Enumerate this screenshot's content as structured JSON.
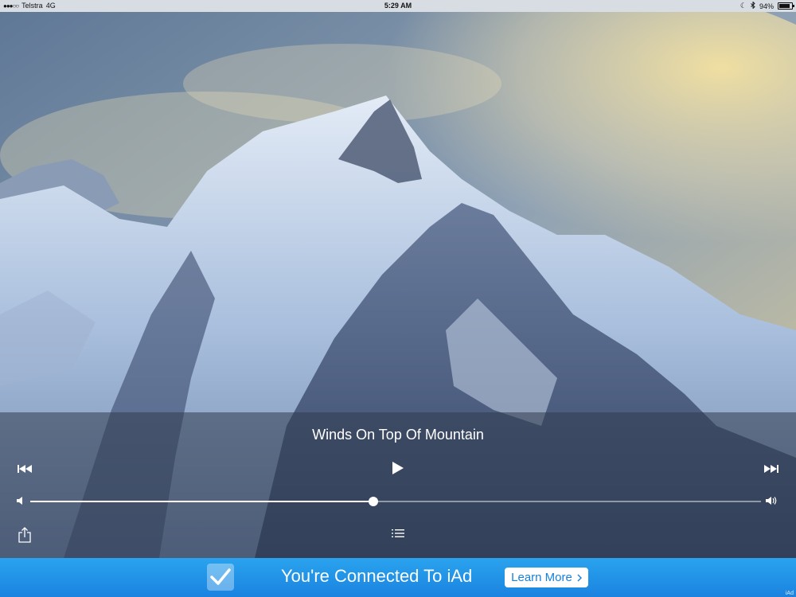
{
  "status_bar": {
    "carrier": "Telstra",
    "network": "4G",
    "time": "5:29 AM",
    "battery": "94%"
  },
  "player": {
    "track_title": "Winds On Top Of Mountain",
    "volume_level": 0.47
  },
  "ad": {
    "text": "You're Connected To iAd",
    "button_label": "Learn More",
    "logo": "iAd"
  },
  "colors": {
    "ad_background": "#1f92e6",
    "panel_overlay": "rgba(50,60,78,0.55)",
    "status_bar": "#d8dde4"
  },
  "icons": [
    "signal-dots-icon",
    "moon-icon",
    "bluetooth-icon",
    "battery-icon",
    "previous-track-icon",
    "play-icon",
    "next-track-icon",
    "volume-low-icon",
    "volume-high-icon",
    "share-icon",
    "playlist-icon",
    "sleep-timer-icon",
    "checkmark-icon",
    "chevron-right-icon"
  ]
}
